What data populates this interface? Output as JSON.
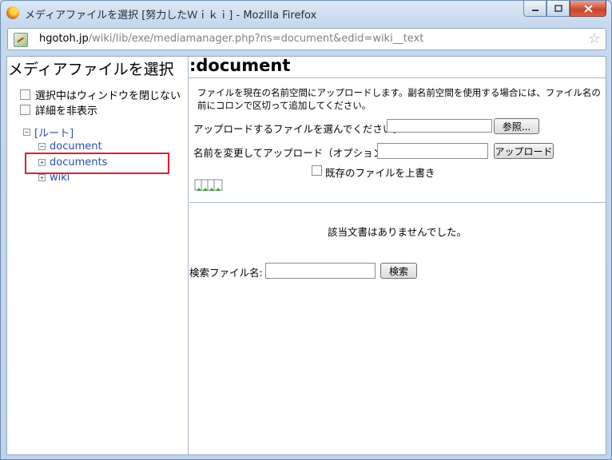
{
  "window": {
    "title": "メディアファイルを選択 [努力したＷｉｋｉ] - Mozilla Firefox",
    "minimize_icon": "minimize-icon",
    "maximize_icon": "maximize-icon",
    "close_icon": "close-icon"
  },
  "urlbar": {
    "host": "hgotoh.jp",
    "path": "/wiki/lib/exe/mediamanager.php?ns=document&edid=wiki__text",
    "bookmark_icon": "star-icon"
  },
  "sidebar": {
    "title": "メディアファイルを選択",
    "options": [
      {
        "label": "選択中はウィンドウを閉じない",
        "checked": false
      },
      {
        "label": "詳細を非表示",
        "checked": false
      }
    ],
    "tree": {
      "root": {
        "label": "[ルート]",
        "toggle": "⊟"
      },
      "items": [
        {
          "label": "document",
          "toggle": "⊟"
        },
        {
          "label": "documents",
          "toggle": "⊞",
          "highlighted": true
        },
        {
          "label": "wiki",
          "toggle": "⊞"
        }
      ]
    },
    "highlight_color": "#e01e2e"
  },
  "main": {
    "title": ":document",
    "upload_info": "ファイルを現在の名前空間にアップロードします。副名前空間を使用する場合には、ファイル名の前にコロンで区切って追加してください。",
    "file_label": "アップロードするファイルを選んでください。:",
    "browse_button": "参照...",
    "rename_label": "名前を変更してアップロード（オプション）:",
    "upload_button": "アップロード",
    "overwrite_label": "既存のファイルを上書き",
    "multi_upload_icon": "multi-upload-icon",
    "no_results": "該当文書はありませんでした。",
    "search_label": "検索ファイル名:",
    "search_button": "検索"
  }
}
